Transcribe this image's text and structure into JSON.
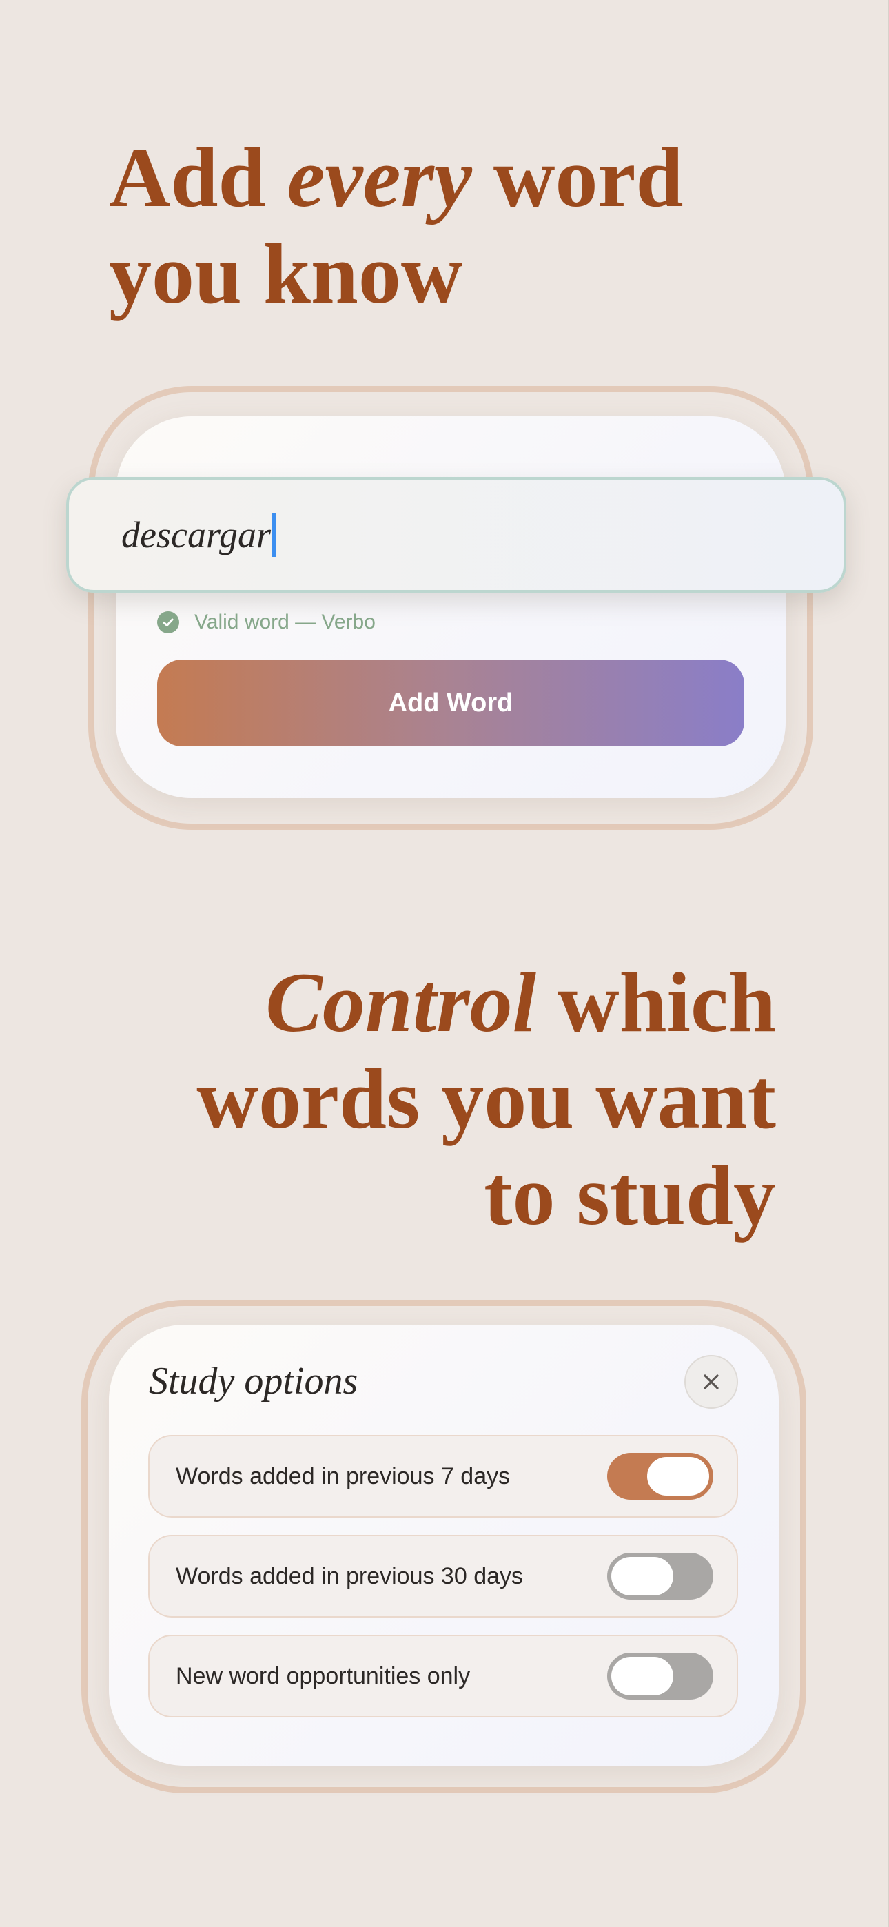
{
  "headline_1": {
    "line1_pre": "Add ",
    "line1_em": "every",
    "line1_post": " word",
    "line2": "you know"
  },
  "add_word_card": {
    "input_value": "descargar",
    "validation_text": "Valid word — Verbo",
    "button_label": "Add Word"
  },
  "headline_2": {
    "line1_em": "Control",
    "line1_post": " which",
    "line2": "words you want",
    "line3": "to study"
  },
  "study_options": {
    "title": "Study options",
    "close_glyph": "×",
    "options": [
      {
        "label": "Words added in previous 7 days",
        "enabled": true
      },
      {
        "label": "Words added in previous 30 days",
        "enabled": false
      },
      {
        "label": "New word opportunities only",
        "enabled": false
      }
    ]
  },
  "colors": {
    "background": "#ede6e1",
    "headline": "#9b4a1d",
    "accent": "#c47b52",
    "valid": "#86a78a",
    "toggle_off": "#a9a7a5",
    "caret": "#3c8ff0"
  },
  "icons": {
    "check": "check-icon",
    "close": "close-icon"
  }
}
